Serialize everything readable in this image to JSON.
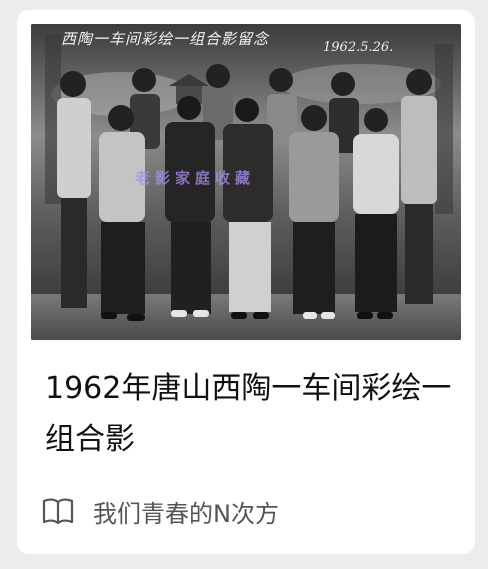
{
  "article": {
    "title": "1962年唐山西陶一车间彩绘一组合影",
    "photo": {
      "handwritten_caption": "西陶一车间彩绘一组合影留念",
      "handwritten_date": "1962.5.26.",
      "watermark": "老影家庭收藏"
    },
    "source": {
      "icon": "book-icon",
      "name": "我们青春的N次方"
    }
  },
  "colors": {
    "background": "#ececec",
    "card": "#ffffff",
    "title_text": "#111111",
    "source_text": "#555555",
    "watermark": "#aa8ceb"
  }
}
